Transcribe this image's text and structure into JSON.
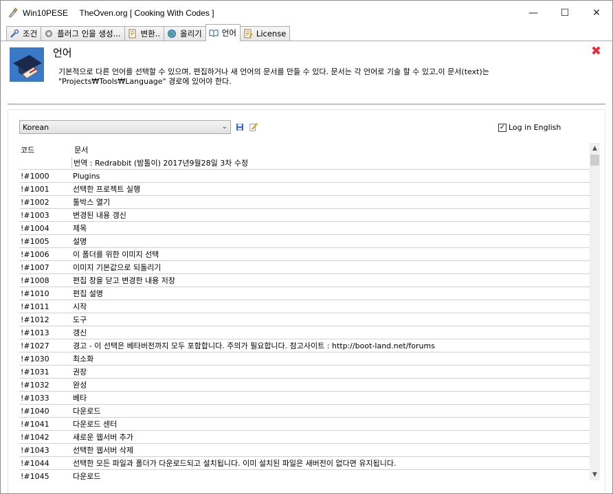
{
  "window": {
    "title": "Win10PESE     TheOven.org [ Cooking With Codes ]",
    "minimize": "—",
    "maximize": "☐",
    "close": "✕"
  },
  "tabs": [
    {
      "label": "조건"
    },
    {
      "label": "플러그 인을 생성..."
    },
    {
      "label": "변환.."
    },
    {
      "label": "올리기"
    },
    {
      "label": "언어"
    },
    {
      "label": "License"
    }
  ],
  "header": {
    "title": "언어",
    "description": "기본적으로 다른 언어를 선택할 수 있으며, 편집하거나 새 언어의 문서를 만들 수 있다. 문서는 각 언어로 기술 할 수 있고,이 문서(text)는 \"Projects₩Tools₩Language\" 경로에 있어야 한다."
  },
  "toolbar": {
    "language_selected": "Korean",
    "save_icon": "save-icon",
    "edit_icon": "edit-icon",
    "log_in_english_label": "Log in English",
    "log_in_english_checked": true
  },
  "grid": {
    "columns": [
      "코드",
      "문서"
    ],
    "rows": [
      {
        "code": "",
        "text": " 번역 : Redrabbit (밤톨이) 2017년9월28일 3차 수정"
      },
      {
        "code": "!#1000",
        "text": "Plugins"
      },
      {
        "code": "!#1001",
        "text": "선택한 프로젝트 실행"
      },
      {
        "code": "!#1002",
        "text": "툴박스 열기"
      },
      {
        "code": "!#1003",
        "text": "변경된 내용 갱신"
      },
      {
        "code": "!#1004",
        "text": "제목"
      },
      {
        "code": "!#1005",
        "text": "설명"
      },
      {
        "code": "!#1006",
        "text": "이 폴더를 위한 이미지 선택"
      },
      {
        "code": "!#1007",
        "text": "이미지 기본값으로 되돌리기"
      },
      {
        "code": "!#1008",
        "text": "편집 창을 닫고 변경한 내용 저장"
      },
      {
        "code": "!#1010",
        "text": " 편집 설명"
      },
      {
        "code": "!#1011",
        "text": "시작"
      },
      {
        "code": "!#1012",
        "text": "도구"
      },
      {
        "code": "!#1013",
        "text": "갱신"
      },
      {
        "code": "!#1027",
        "text": " 경고 - 이 선택은 베타버전까지 모두 포함합니다. 주의가 필요합니다. 참고사이트 :  http://boot-land.net/forums"
      },
      {
        "code": "!#1030",
        "text": "최소화"
      },
      {
        "code": "!#1031",
        "text": "권장"
      },
      {
        "code": "!#1032",
        "text": "완성"
      },
      {
        "code": "!#1033",
        "text": "베타"
      },
      {
        "code": "!#1040",
        "text": "다운로드"
      },
      {
        "code": "!#1041",
        "text": "다운로드 센터"
      },
      {
        "code": "!#1042",
        "text": "새로운 웹서버 추가"
      },
      {
        "code": "!#1043",
        "text": "선택한 웹서버 삭제"
      },
      {
        "code": "!#1044",
        "text": "선택한 모든 파일과 폴더가 다운로드되고 설치됩니다. 이미 설치된 파일은 새버전이 없다면 유지됩니다."
      },
      {
        "code": "!#1045",
        "text": "다운로드"
      }
    ]
  },
  "colors": {
    "close_x": "#e0303c",
    "grid_line": "#d0d0d0",
    "separator": "#8a8a8a"
  }
}
